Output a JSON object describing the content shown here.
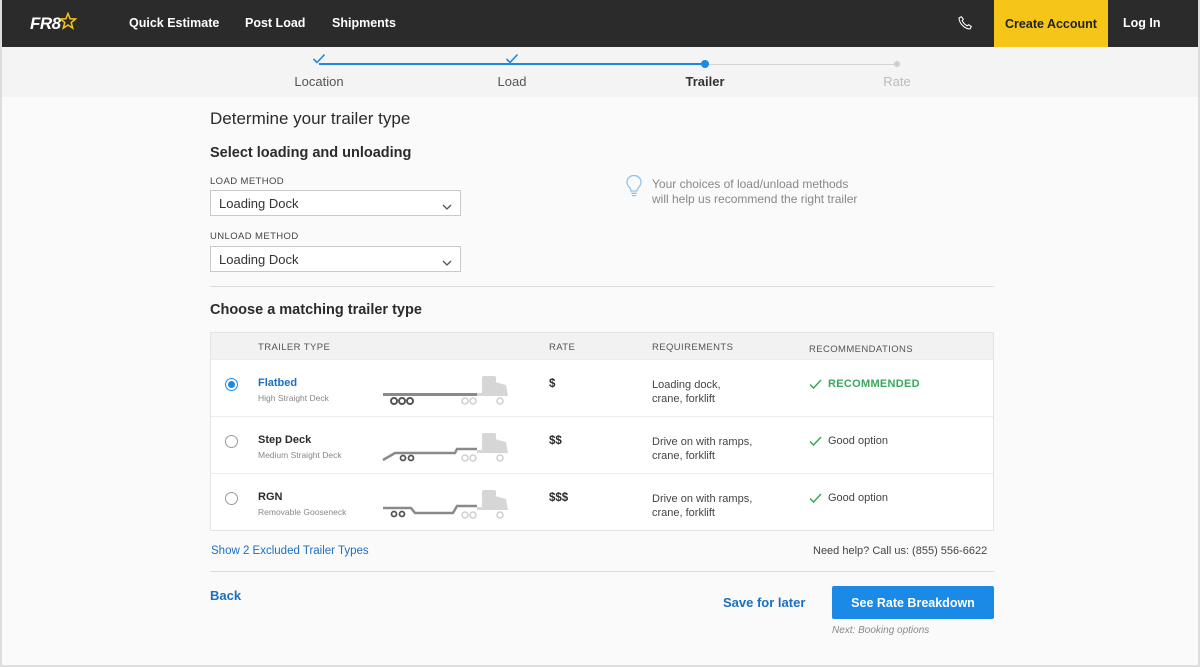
{
  "nav": {
    "logo": "FR8",
    "links": [
      "Quick Estimate",
      "Post Load",
      "Shipments"
    ],
    "create_account": "Create Account",
    "login": "Log In"
  },
  "stepper": {
    "steps": [
      {
        "label": "Location",
        "state": "done"
      },
      {
        "label": "Load",
        "state": "done"
      },
      {
        "label": "Trailer",
        "state": "current"
      },
      {
        "label": "Rate",
        "state": "todo"
      }
    ]
  },
  "page": {
    "title": "Determine your trailer type",
    "section1": "Select loading and unloading",
    "load_method_label": "LOAD METHOD",
    "load_method_value": "Loading Dock",
    "unload_method_label": "UNLOAD METHOD",
    "unload_method_value": "Loading Dock",
    "tip_line1": "Your choices of load/unload methods",
    "tip_line2": "will help us recommend the right trailer",
    "section2": "Choose a matching trailer type"
  },
  "table": {
    "headers": {
      "type": "TRAILER TYPE",
      "rate": "RATE",
      "requirements": "REQUIREMENTS",
      "recommendations": "RECOMMENDATIONS"
    },
    "rows": [
      {
        "name": "Flatbed",
        "sub": "High Straight Deck",
        "rate": "$",
        "req1": "Loading dock,",
        "req2": "crane, forklift",
        "rec": "RECOMMENDED",
        "selected": true
      },
      {
        "name": "Step Deck",
        "sub": "Medium Straight Deck",
        "rate": "$$",
        "req1": "Drive on with ramps,",
        "req2": "crane, forklift",
        "rec": "Good option",
        "selected": false
      },
      {
        "name": "RGN",
        "sub": "Removable Gooseneck",
        "rate": "$$$",
        "req1": "Drive on with ramps,",
        "req2": "crane, forklift",
        "rec": "Good option",
        "selected": false
      }
    ]
  },
  "footer": {
    "excluded_link": "Show 2 Excluded Trailer Types",
    "help": "Need help? Call us: (855) 556-6622",
    "back": "Back",
    "save": "Save for later",
    "cta": "See Rate Breakdown",
    "next": "Next: Booking options"
  },
  "colors": {
    "accent": "#1a8ae6",
    "brand_yellow": "#f5c518",
    "success": "#3aa85c",
    "nav_bg": "#2b2b2b"
  }
}
